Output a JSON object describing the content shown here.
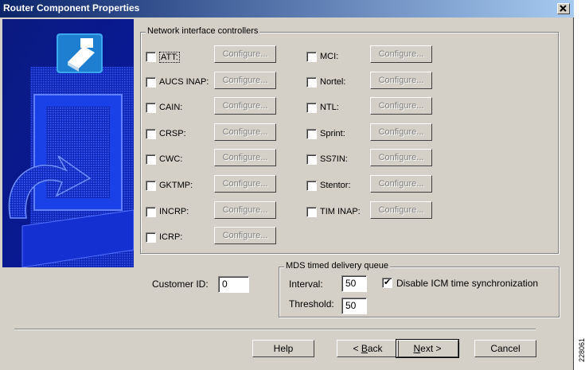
{
  "window": {
    "title": "Router Component Properties"
  },
  "group_nic": {
    "legend": "Network interface controllers",
    "configure_label": "Configure...",
    "left_items": [
      "ATT:",
      "AUCS INAP:",
      "CAIN:",
      "CRSP:",
      "CWC:",
      "GKTMP:",
      "INCRP:",
      "ICRP:"
    ],
    "right_items": [
      "MCI:",
      "Nortel:",
      "NTL:",
      "Sprint:",
      "SS7IN:",
      "Stentor:",
      "TIM INAP:"
    ]
  },
  "customer": {
    "label": "Customer ID:",
    "value": "0"
  },
  "mds": {
    "legend": "MDS timed delivery queue",
    "interval_label": "Interval:",
    "interval_value": "50",
    "threshold_label": "Threshold:",
    "threshold_value": "50",
    "disable_sync_label": "Disable ICM time synchronization",
    "disable_sync_checked": true
  },
  "buttons": {
    "help": "Help",
    "back_pre": "< ",
    "back_u": "B",
    "back_post": "ack",
    "next_u": "N",
    "next_post": "ext >",
    "cancel": "Cancel"
  },
  "doc_id": "228061",
  "colors": {
    "titlebar_start": "#0a246a",
    "titlebar_end": "#a6caf0",
    "dialog_bg": "#d4d0c8",
    "graphic_blue": "#1a3ce0"
  },
  "icons": {
    "close": "close-icon",
    "side_graphic": "router-graphic"
  }
}
